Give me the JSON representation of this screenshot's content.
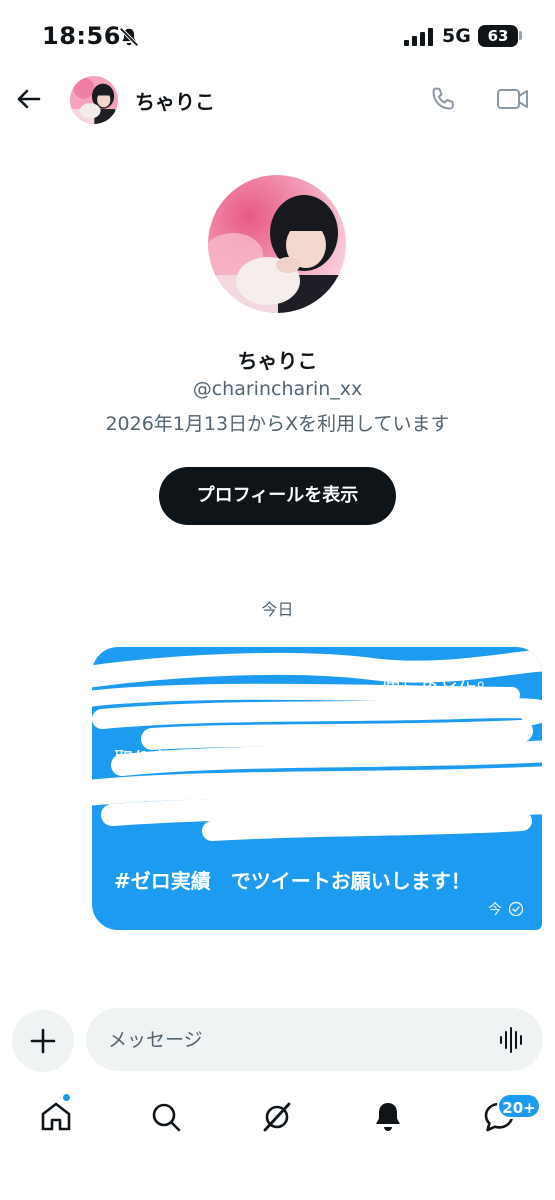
{
  "status_bar": {
    "time": "18:56",
    "network": "5G",
    "battery": "63"
  },
  "header": {
    "back_icon": "back-arrow-icon",
    "name": "ちゃりこ",
    "call_icon": "phone-icon",
    "video_icon": "video-camera-icon"
  },
  "profile": {
    "name": "ちゃりこ",
    "handle": "@charincharin_xx",
    "joined": "2026年1月13日からXを利用しています",
    "view_profile_label": "プロフィールを表示"
  },
  "conversation": {
    "date_divider": "今日",
    "messages": [
      {
        "visible_fragments": [
          "届きました。",
          "取りを",
          "#ゼロ実績　でツイートお願いします！"
        ],
        "redacted": true,
        "timestamp": "今",
        "status_icon": "read-check-icon"
      }
    ]
  },
  "composer": {
    "add_icon": "plus-icon",
    "placeholder": "メッセージ",
    "voice_icon": "voice-waveform-icon"
  },
  "bottom_nav": {
    "items": [
      "home-icon",
      "search-icon",
      "grok-icon",
      "notifications-bell-icon",
      "messages-icon"
    ],
    "messages_badge": "20+"
  },
  "colors": {
    "accent": "#1d9bf0",
    "text_primary": "#0f1419",
    "text_secondary": "#536471",
    "surface": "#eff3f4"
  }
}
